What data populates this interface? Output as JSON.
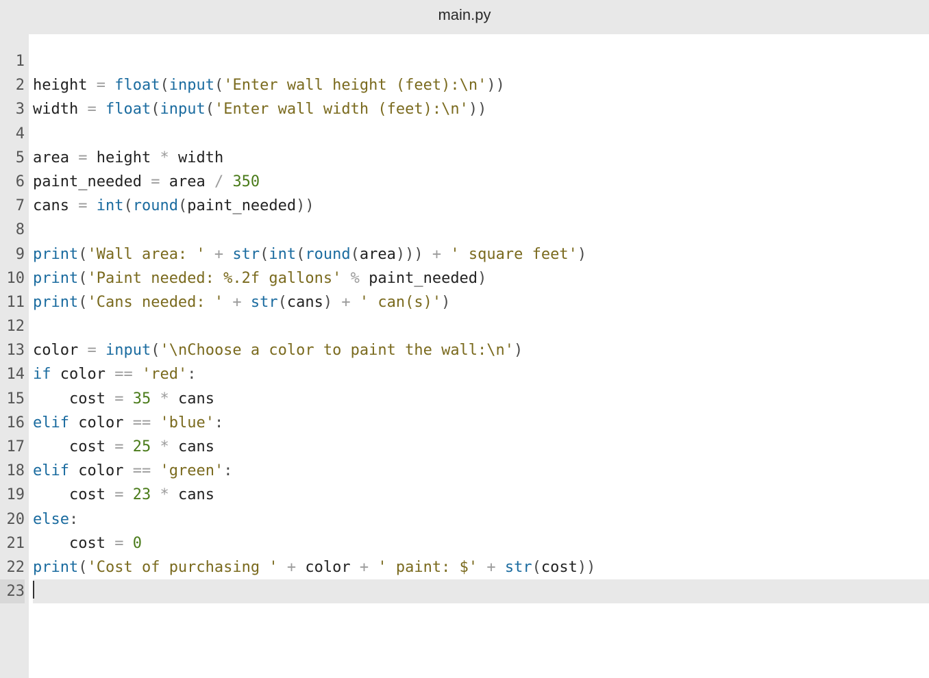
{
  "header": {
    "filename": "main.py"
  },
  "editor": {
    "line_count": 23,
    "current_line": 23,
    "lines": [
      {
        "n": 1,
        "t": ""
      },
      {
        "n": 2,
        "t": "height = float(input('Enter wall height (feet):\\n'))"
      },
      {
        "n": 3,
        "t": "width = float(input('Enter wall width (feet):\\n'))"
      },
      {
        "n": 4,
        "t": ""
      },
      {
        "n": 5,
        "t": "area = height * width"
      },
      {
        "n": 6,
        "t": "paint_needed = area / 350"
      },
      {
        "n": 7,
        "t": "cans = int(round(paint_needed))"
      },
      {
        "n": 8,
        "t": ""
      },
      {
        "n": 9,
        "t": "print('Wall area: ' + str(int(round(area))) + ' square feet')"
      },
      {
        "n": 10,
        "t": "print('Paint needed: %.2f gallons' % paint_needed)"
      },
      {
        "n": 11,
        "t": "print('Cans needed: ' + str(cans) + ' can(s)')"
      },
      {
        "n": 12,
        "t": ""
      },
      {
        "n": 13,
        "t": "color = input('\\nChoose a color to paint the wall:\\n')"
      },
      {
        "n": 14,
        "t": "if color == 'red':"
      },
      {
        "n": 15,
        "t": "    cost = 35 * cans"
      },
      {
        "n": 16,
        "t": "elif color == 'blue':"
      },
      {
        "n": 17,
        "t": "    cost = 25 * cans"
      },
      {
        "n": 18,
        "t": "elif color == 'green':"
      },
      {
        "n": 19,
        "t": "    cost = 23 * cans"
      },
      {
        "n": 20,
        "t": "else:"
      },
      {
        "n": 21,
        "t": "    cost = 0"
      },
      {
        "n": 22,
        "t": "print('Cost of purchasing ' + color + ' paint: $' + str(cost))"
      },
      {
        "n": 23,
        "t": ""
      }
    ]
  },
  "syntax": {
    "builtins": [
      "float",
      "input",
      "int",
      "round",
      "print",
      "str"
    ],
    "keywords": [
      "if",
      "elif",
      "else"
    ]
  }
}
